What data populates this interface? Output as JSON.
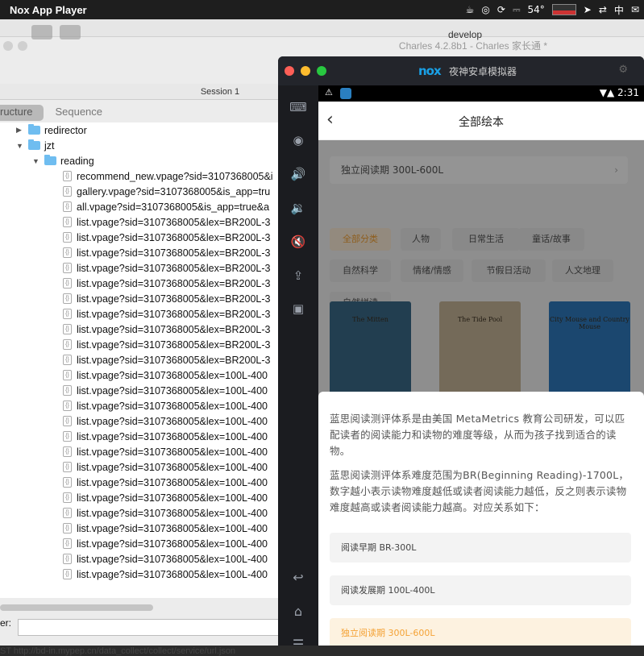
{
  "menubar": {
    "app_name": "Nox App Player",
    "temp": "54°",
    "ime": "中"
  },
  "charles": {
    "tab_develop": "develop",
    "window_title": "Charles 4.2.8b1 - Charles 家长通 *",
    "session_label": "Session 1",
    "tab_structure": "ructure",
    "tab_sequence": "Sequence",
    "tree": [
      {
        "kind": "folder",
        "label": "redirector",
        "level": 1,
        "open": false
      },
      {
        "kind": "folder",
        "label": "jzt",
        "level": 1,
        "open": true
      },
      {
        "kind": "folder",
        "label": "reading",
        "level": 2,
        "open": true
      },
      {
        "kind": "file",
        "label": "recommend_new.vpage?sid=3107368005&i"
      },
      {
        "kind": "file",
        "label": "gallery.vpage?sid=3107368005&is_app=tru"
      },
      {
        "kind": "file",
        "label": "all.vpage?sid=3107368005&is_app=true&a"
      },
      {
        "kind": "file",
        "label": "list.vpage?sid=3107368005&lex=BR200L-3"
      },
      {
        "kind": "file",
        "label": "list.vpage?sid=3107368005&lex=BR200L-3"
      },
      {
        "kind": "file",
        "label": "list.vpage?sid=3107368005&lex=BR200L-3"
      },
      {
        "kind": "file",
        "label": "list.vpage?sid=3107368005&lex=BR200L-3"
      },
      {
        "kind": "file",
        "label": "list.vpage?sid=3107368005&lex=BR200L-3"
      },
      {
        "kind": "file",
        "label": "list.vpage?sid=3107368005&lex=BR200L-3"
      },
      {
        "kind": "file",
        "label": "list.vpage?sid=3107368005&lex=BR200L-3"
      },
      {
        "kind": "file",
        "label": "list.vpage?sid=3107368005&lex=BR200L-3"
      },
      {
        "kind": "file",
        "label": "list.vpage?sid=3107368005&lex=BR200L-3"
      },
      {
        "kind": "file",
        "label": "list.vpage?sid=3107368005&lex=BR200L-3"
      },
      {
        "kind": "file",
        "label": "list.vpage?sid=3107368005&lex=100L-400"
      },
      {
        "kind": "file",
        "label": "list.vpage?sid=3107368005&lex=100L-400"
      },
      {
        "kind": "file",
        "label": "list.vpage?sid=3107368005&lex=100L-400"
      },
      {
        "kind": "file",
        "label": "list.vpage?sid=3107368005&lex=100L-400"
      },
      {
        "kind": "file",
        "label": "list.vpage?sid=3107368005&lex=100L-400"
      },
      {
        "kind": "file",
        "label": "list.vpage?sid=3107368005&lex=100L-400"
      },
      {
        "kind": "file",
        "label": "list.vpage?sid=3107368005&lex=100L-400"
      },
      {
        "kind": "file",
        "label": "list.vpage?sid=3107368005&lex=100L-400"
      },
      {
        "kind": "file",
        "label": "list.vpage?sid=3107368005&lex=100L-400"
      },
      {
        "kind": "file",
        "label": "list.vpage?sid=3107368005&lex=100L-400"
      },
      {
        "kind": "file",
        "label": "list.vpage?sid=3107368005&lex=100L-400"
      },
      {
        "kind": "file",
        "label": "list.vpage?sid=3107368005&lex=100L-400"
      },
      {
        "kind": "file",
        "label": "list.vpage?sid=3107368005&lex=100L-400"
      },
      {
        "kind": "file",
        "label": "list.vpage?sid=3107368005&lex=100L-400"
      }
    ],
    "filter_label": "er:",
    "filter_value": "",
    "status_text": "ST http://bd-in.mypep.cn/data_collect/collect/service/url.json"
  },
  "nox": {
    "logo": "nox",
    "title": "夜神安卓模拟器",
    "status_time": "2:31",
    "app_title": "全部绘本",
    "level_selector": "独立阅读期 300L-600L",
    "categories": [
      {
        "label": "全部分类",
        "selected": true
      },
      {
        "label": "人物",
        "selected": false
      },
      {
        "label": "日常生活",
        "selected": false
      },
      {
        "label": "童话/故事",
        "selected": false
      },
      {
        "label": "自然科学",
        "selected": false
      },
      {
        "label": "情绪/情感",
        "selected": false
      },
      {
        "label": "节假日活动",
        "selected": false
      },
      {
        "label": "人文地理",
        "selected": false
      },
      {
        "label": "自然拼读",
        "selected": false
      }
    ],
    "books": [
      {
        "title": "The Mitten",
        "color": "#3b6b8a"
      },
      {
        "title": "The Tide Pool",
        "color": "#c9b79a"
      },
      {
        "title": "City Mouse and Country Mouse",
        "color": "#2f7bbf"
      }
    ],
    "sheet": {
      "para1": "蓝思阅读测评体系是由美国 MetaMetrics 教育公司研发，可以匹配读者的阅读能力和读物的难度等级，从而为孩子找到适合的读物。",
      "para2": "蓝思阅读测评体系难度范围为BR(Beginning Reading)-1700L，数字越小表示读物难度越低或读者阅读能力越低，反之则表示读物难度越高或读者阅读能力越高。对应关系如下：",
      "levels": [
        {
          "label": "阅读早期 BR-300L",
          "selected": false
        },
        {
          "label": "阅读发展期 100L-400L",
          "selected": false
        },
        {
          "label": "独立阅读期 300L-600L",
          "selected": true
        }
      ]
    }
  }
}
